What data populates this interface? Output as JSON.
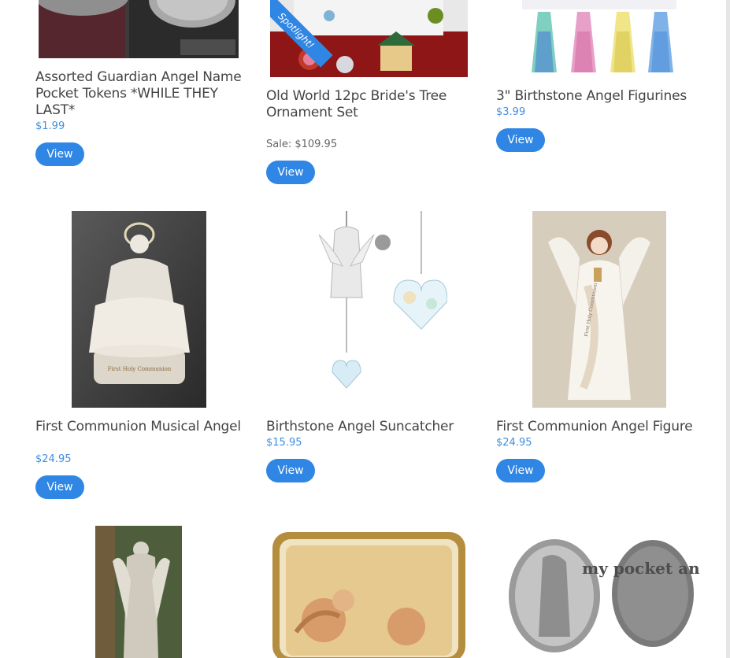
{
  "products": [
    {
      "title": "Assorted Guardian Angel Name Pocket Tokens *WHILE THEY LAST*",
      "price": "$1.99",
      "button": "View"
    },
    {
      "title": "Old World 12pc Bride's Tree Ornament Set",
      "sale": "Sale: $109.95",
      "badge": "Spotlight!",
      "button": "View"
    },
    {
      "title": "3\" Birthstone Angel Figurines",
      "price": "$3.99",
      "button": "View"
    },
    {
      "title": "First Communion Musical Angel",
      "price": "$24.95",
      "button": "View"
    },
    {
      "title": "Birthstone Angel Suncatcher",
      "price": "$15.95",
      "button": "View"
    },
    {
      "title": "First Communion Angel Figure",
      "price": "$24.95",
      "button": "View"
    }
  ],
  "image_text": {
    "musical_base": "First Holy Communion",
    "pocket_angel": "my pocket angel",
    "figure_sash": "First Holy Communion"
  },
  "colors": {
    "accent": "#2f86e4",
    "price": "#3f8fe0"
  }
}
